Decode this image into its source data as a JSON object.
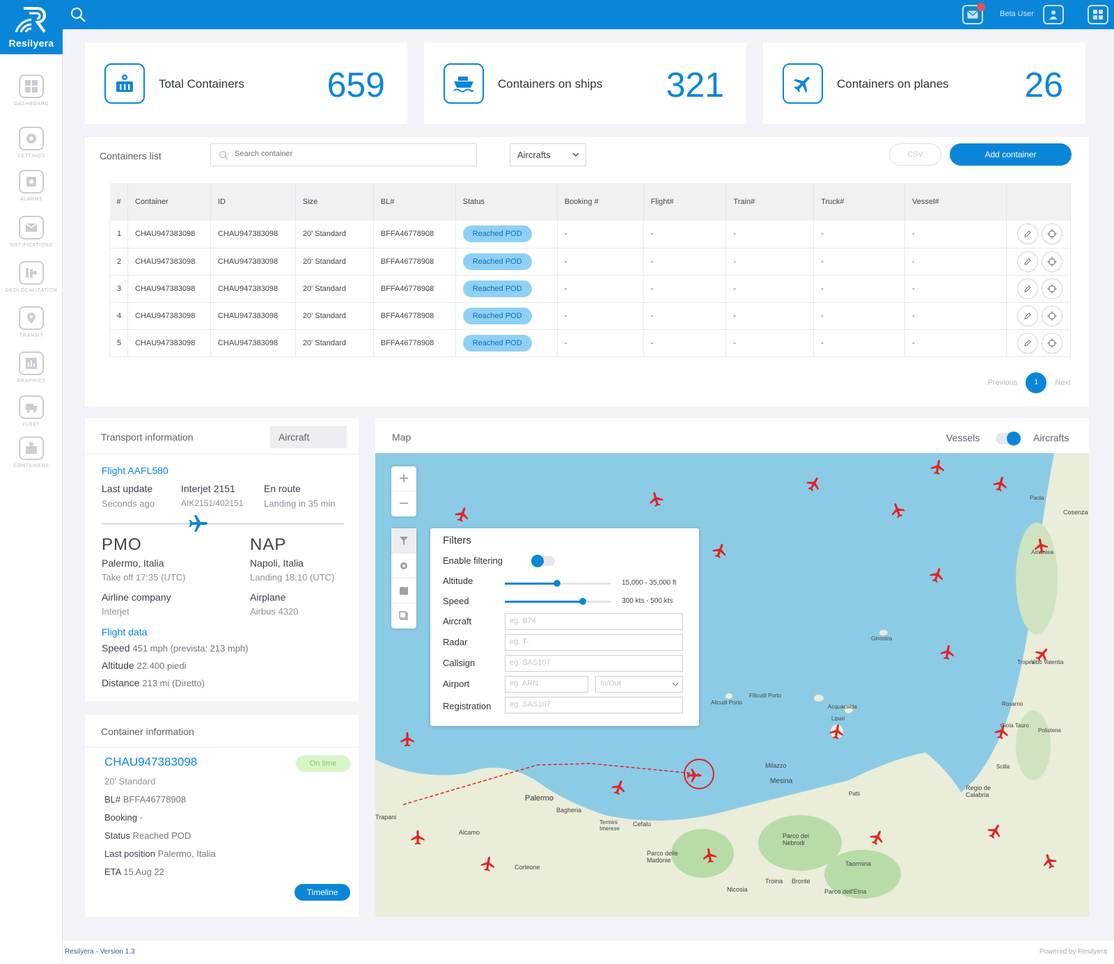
{
  "app": {
    "brand": "Resilyera",
    "user_label": "Beta User"
  },
  "sidebar": {
    "items": [
      {
        "label": "DASHBOARD",
        "icon": "dashboard-icon"
      },
      {
        "label": "SETTINGS",
        "icon": "settings-icon"
      },
      {
        "label": "ALARMS",
        "icon": "alarm-icon"
      },
      {
        "label": "NOTIFICATIONS",
        "icon": "notification-icon"
      },
      {
        "label": "GEOLOCALIZATION",
        "icon": "geolocalization-icon"
      },
      {
        "label": "TRANSIT",
        "icon": "location-pin-icon"
      },
      {
        "label": "GRAPHICS",
        "icon": "chart-icon"
      },
      {
        "label": "FLEET",
        "icon": "truck-icon"
      },
      {
        "label": "CONTAINERS",
        "icon": "container-icon"
      }
    ]
  },
  "stats": [
    {
      "label": "Total Containers",
      "value": "659",
      "icon": "container-icon"
    },
    {
      "label": "Containers on ships",
      "value": "321",
      "icon": "ship-icon"
    },
    {
      "label": "Containers on planes",
      "value": "26",
      "icon": "airplane-icon"
    }
  ],
  "containers_list": {
    "title": "Containers list",
    "search_placeholder": "Search container",
    "filter_value": "Aircrafts",
    "csv_label": "CSV",
    "add_label": "Add container",
    "columns": [
      "#",
      "Container",
      "ID",
      "Size",
      "BL#",
      "Status",
      "Booking #",
      "Flight#",
      "Train#",
      "Truck#",
      "Vessel#",
      ""
    ],
    "rows": [
      {
        "n": "1",
        "container": "CHAU947383098",
        "id": "CHAU947383098",
        "size": "20' Standard",
        "bl": "BFFA46778908",
        "status": "Reached POD",
        "booking": "-",
        "flight": "-",
        "train": "-",
        "truck": "-",
        "vessel": "-"
      },
      {
        "n": "2",
        "container": "CHAU947383098",
        "id": "CHAU947383098",
        "size": "20' Standard",
        "bl": "BFFA46778908",
        "status": "Reached POD",
        "booking": "-",
        "flight": "-",
        "train": "-",
        "truck": "-",
        "vessel": "-"
      },
      {
        "n": "3",
        "container": "CHAU947383098",
        "id": "CHAU947383098",
        "size": "20' Standard",
        "bl": "BFFA46778908",
        "status": "Reached POD",
        "booking": "-",
        "flight": "-",
        "train": "-",
        "truck": "-",
        "vessel": "-"
      },
      {
        "n": "4",
        "container": "CHAU947383098",
        "id": "CHAU947383098",
        "size": "20' Standard",
        "bl": "BFFA46778908",
        "status": "Reached POD",
        "booking": "-",
        "flight": "-",
        "train": "-",
        "truck": "-",
        "vessel": "-"
      },
      {
        "n": "5",
        "container": "CHAU947383098",
        "id": "CHAU947383098",
        "size": "20' Standard",
        "bl": "BFFA46778908",
        "status": "Reached POD",
        "booking": "-",
        "flight": "-",
        "train": "-",
        "truck": "-",
        "vessel": "-"
      }
    ],
    "pagination": {
      "previous": "Previous",
      "page": "1",
      "next": "Next"
    }
  },
  "transport": {
    "title": "Transport information",
    "mode": "Aircraft",
    "flight": "Flight AAFL580",
    "last_update_label": "Last update",
    "last_update_value": "Seconds ago",
    "aircraft_name": "Interjet 2151",
    "aircraft_code": "AIK2151/402151",
    "state": "En route",
    "landing_in": "Landing in 35 min",
    "progress": 0.4,
    "origin": {
      "code": "PMO",
      "city": "Palermo, Italia",
      "time": "Take off 17:35 (UTC)"
    },
    "destination": {
      "code": "NAP",
      "city": "Napoli, Italia",
      "time": "Landing 18:10 (UTC)"
    },
    "airline_label": "Airline company",
    "airline_value": "Interjet",
    "airplane_label": "Airplane",
    "airplane_value": "Airbus 4320",
    "flight_data_title": "Flight data",
    "speed_label": "Speed",
    "speed_value": "451 mph (prevista: 213 mph)",
    "altitude_label": "Altitude",
    "altitude_value": "22.400 piedi",
    "distance_label": "Distance",
    "distance_value": "213 mi (Diretto)"
  },
  "container_info": {
    "title": "Container information",
    "code": "CHAU947383098",
    "status_badge": "On time",
    "size": "20' Standard",
    "bl_label": "BL#",
    "bl_value": "BFFA46778908",
    "booking_label": "Booking",
    "booking_value": "-",
    "status_label": "Status",
    "status_value": "Reached POD",
    "last_position_label": "Last position",
    "last_position_value": "Palermo, Italia",
    "eta_label": "ETA",
    "eta_value": "15 Aug 22",
    "timeline_label": "Timeline"
  },
  "map": {
    "title": "Map",
    "toggle_left": "Vessels",
    "toggle_right": "Aircrafts",
    "zoom_in": "+",
    "zoom_out": "−",
    "place_labels": [
      "Palermo",
      "Mesina",
      "Milazzo",
      "Bagheria",
      "Alcamo",
      "Trapani",
      "Corleone",
      "Cefalu",
      "Taormina",
      "Bronte",
      "Troina",
      "Nicosia",
      "Paola",
      "Cosenza",
      "Tropea",
      "Rosarno",
      "Lipari",
      "Acquacalda",
      "Ginostra",
      "Filicudi Porto",
      "Alicudi Porto",
      "Regio de Calabria",
      "Parco dei Nebrodi",
      "Parco dell'Etna",
      "Parco delle Madonie",
      "Termini Imerese",
      "Patti",
      "Amantea",
      "Scilla",
      "Polistena",
      "Gioia Tauro",
      "Vibo Valentia"
    ],
    "filters": {
      "title": "Filters",
      "enable_label": "Enable filtering",
      "altitude_label": "Altitude",
      "altitude_range": "15,000 - 35,000 ft",
      "speed_label": "Speed",
      "speed_range": "300 kts - 500 kts",
      "aircraft_label": "Aircraft",
      "aircraft_placeholder": "eg. B74",
      "radar_label": "Radar",
      "radar_placeholder": "eg. T-",
      "callsign_label": "Callsign",
      "callsign_placeholder": "eg. SAS107",
      "airport_label": "Airport",
      "airport_placeholder": "eg. ARN",
      "airport_direction": "In/Out",
      "registration_label": "Registration",
      "registration_placeholder": "eg. SAS107"
    }
  },
  "footer": {
    "left": "Resilyera - Version 1.3",
    "right": "Powered by Resilyera"
  },
  "colors": {
    "primary": "#0a86d8",
    "plane": "#e02424",
    "badge": "#8ed0f5",
    "on_time": "#d8f5c8"
  }
}
